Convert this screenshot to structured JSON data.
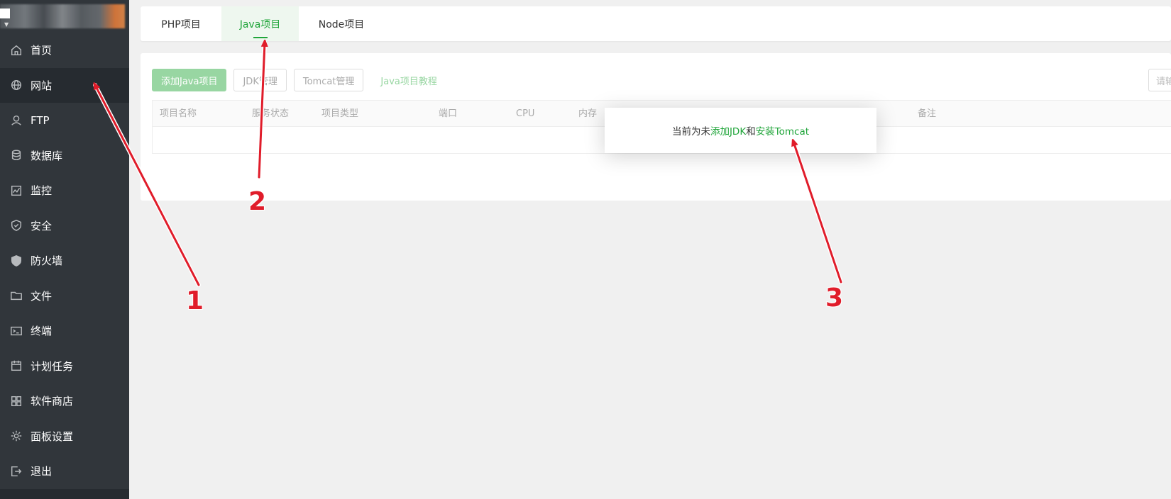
{
  "sidebar": {
    "items": [
      {
        "label": "首页",
        "icon": "home-icon"
      },
      {
        "label": "网站",
        "icon": "globe-icon"
      },
      {
        "label": "FTP",
        "icon": "ftp-icon"
      },
      {
        "label": "数据库",
        "icon": "database-icon"
      },
      {
        "label": "监控",
        "icon": "monitor-icon"
      },
      {
        "label": "安全",
        "icon": "shield-check-icon"
      },
      {
        "label": "防火墙",
        "icon": "firewall-icon"
      },
      {
        "label": "文件",
        "icon": "folder-icon"
      },
      {
        "label": "终端",
        "icon": "terminal-icon"
      },
      {
        "label": "计划任务",
        "icon": "calendar-icon"
      },
      {
        "label": "软件商店",
        "icon": "apps-icon"
      },
      {
        "label": "面板设置",
        "icon": "gear-icon"
      },
      {
        "label": "退出",
        "icon": "logout-icon"
      }
    ],
    "active_index": 1
  },
  "tabs": [
    {
      "label": "PHP项目"
    },
    {
      "label": "Java项目"
    },
    {
      "label": "Node项目"
    }
  ],
  "toolbar": {
    "add_label": "添加Java项目",
    "jdk_label": "JDK管理",
    "tomcat_label": "Tomcat管理",
    "tutorial_label": "Java项目教程",
    "search_placeholder": "请输"
  },
  "table": {
    "headers": [
      "项目名称",
      "服务状态",
      "项目类型",
      "端口",
      "CPU",
      "内存",
      "备注"
    ]
  },
  "popup": {
    "prefix": "当前为未",
    "link1": "添加JDK",
    "middle": "和",
    "link2": "安装Tomcat"
  },
  "annotations": [
    "1",
    "2",
    "3"
  ],
  "colors": {
    "sidebar_bg": "#31363b",
    "accent": "#20a53a",
    "annotation": "#e01c2a"
  }
}
